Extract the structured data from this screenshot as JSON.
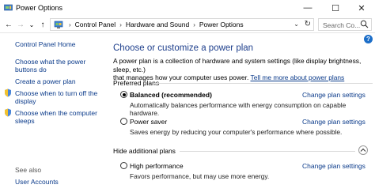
{
  "window": {
    "title": "Power Options",
    "minimize_glyph": "—",
    "maximize_glyph": "☐",
    "close_glyph": "✕"
  },
  "nav": {
    "back_glyph": "←",
    "forward_glyph": "→",
    "recent_glyph": "⌄",
    "up_glyph": "↑",
    "breadcrumbs": [
      "Control Panel",
      "Hardware and Sound",
      "Power Options"
    ],
    "separator": "›",
    "dropdown_glyph": "⌄",
    "refresh_glyph": "↻",
    "search_placeholder": "Search Co..."
  },
  "sidebar": {
    "home": "Control Panel Home",
    "links": [
      {
        "line1": "Choose what the power",
        "line2": "buttons do"
      },
      {
        "line1": "Create a power plan"
      },
      {
        "line1": "Choose when to turn off the",
        "line2": "display"
      },
      {
        "line1": "Choose when the computer",
        "line2": "sleeps"
      }
    ],
    "see_also": "See also",
    "user_accounts": "User Accounts"
  },
  "help_glyph": "?",
  "main": {
    "heading": "Choose or customize a power plan",
    "description_1": "A power plan is a collection of hardware and system settings (like display brightness, sleep, etc.)",
    "description_2": "that manages how your computer uses power.",
    "description_link": "Tell me more about power plans",
    "preferred_plans_label": "Preferred plans",
    "hide_additional_label": "Hide additional plans",
    "plans": [
      {
        "name": "Balanced (recommended)",
        "description": "Automatically balances performance with energy consumption on capable hardware.",
        "link": "Change plan settings",
        "selected": true
      },
      {
        "name": "Power saver",
        "description": "Saves energy by reducing your computer's performance where possible.",
        "link": "Change plan settings",
        "selected": false
      },
      {
        "name": "High performance",
        "description": "Favors performance, but may use more energy.",
        "link": "Change plan settings",
        "selected": false
      }
    ],
    "collapse_glyph": "︿"
  },
  "colors": {
    "link": "#0a3a8a",
    "heading": "#1e3f8c",
    "help_badge": "#1c6ec8"
  }
}
